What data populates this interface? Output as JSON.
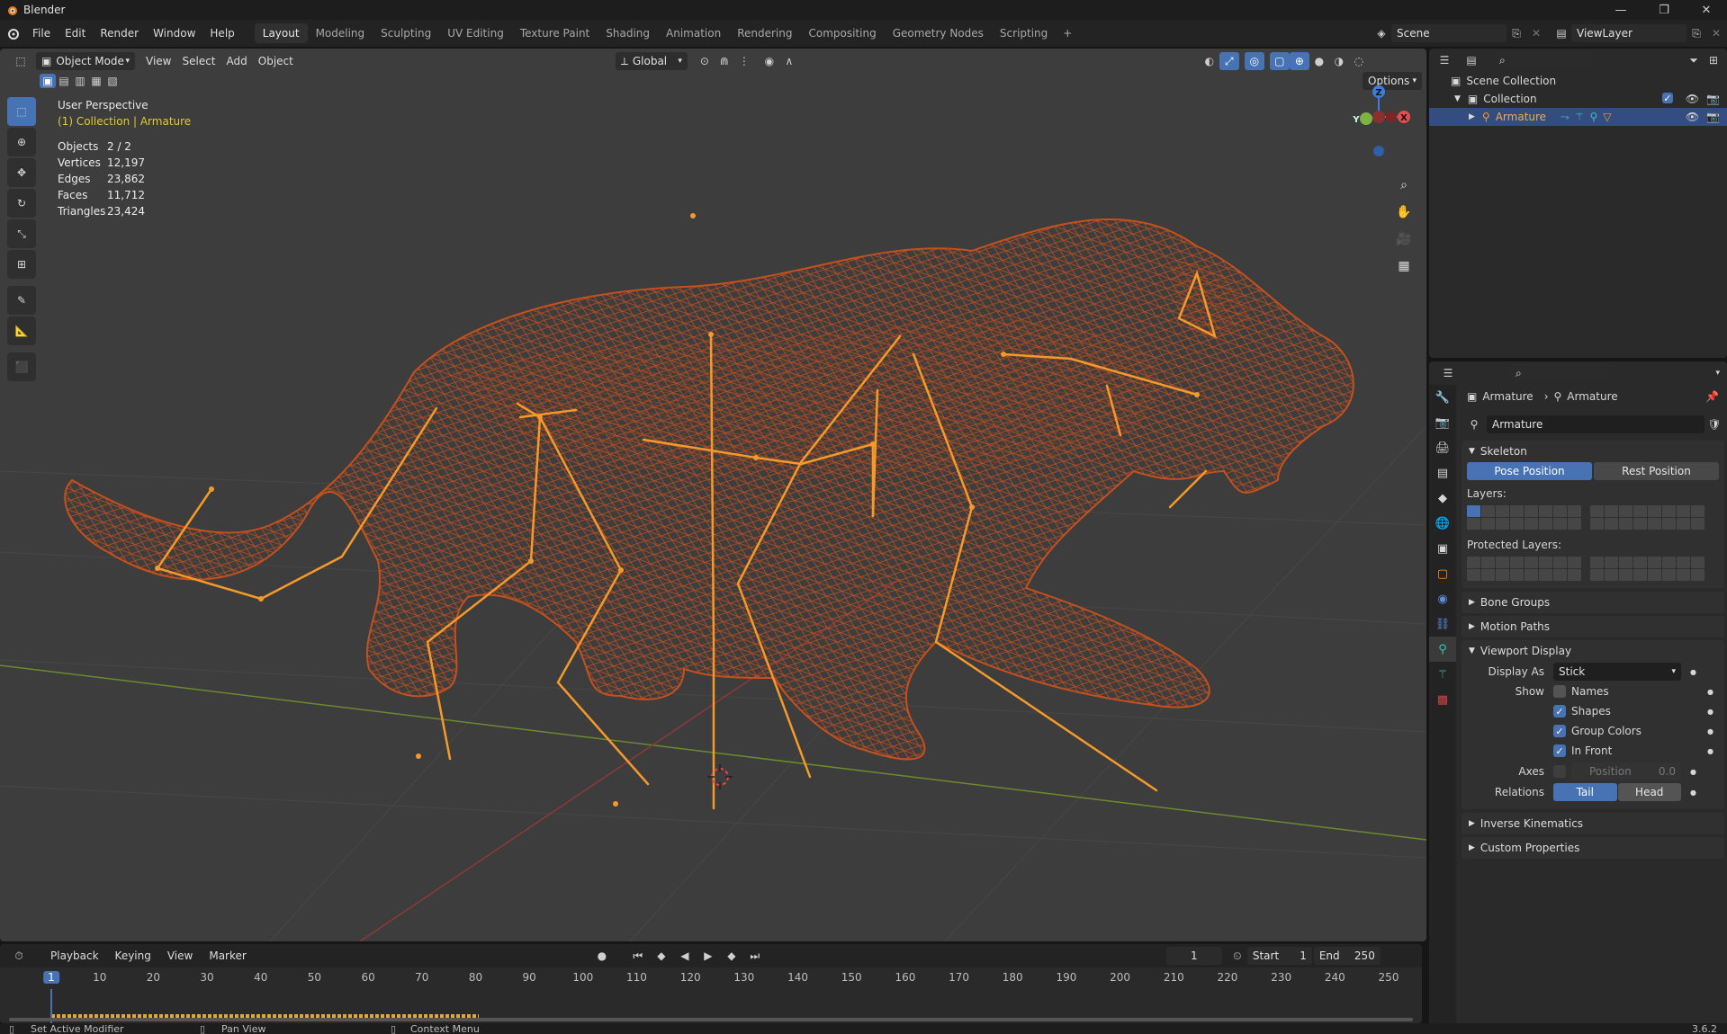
{
  "window": {
    "title": "Blender",
    "version": "3.6.2"
  },
  "menus": [
    "File",
    "Edit",
    "Render",
    "Window",
    "Help"
  ],
  "workspaces": [
    {
      "label": "Layout",
      "active": true
    },
    {
      "label": "Modeling"
    },
    {
      "label": "Sculpting"
    },
    {
      "label": "UV Editing"
    },
    {
      "label": "Texture Paint"
    },
    {
      "label": "Shading"
    },
    {
      "label": "Animation"
    },
    {
      "label": "Rendering"
    },
    {
      "label": "Compositing"
    },
    {
      "label": "Geometry Nodes"
    },
    {
      "label": "Scripting"
    }
  ],
  "scene": {
    "name": "Scene",
    "view_layer": "ViewLayer"
  },
  "viewport": {
    "mode": "Object Mode",
    "menus": [
      "View",
      "Select",
      "Add",
      "Object"
    ],
    "orientation": "Global",
    "options_label": "Options",
    "view_name": "User Perspective",
    "collection_line": "(1) Collection | Armature",
    "stats": [
      {
        "label": "Objects",
        "value": "2 / 2"
      },
      {
        "label": "Vertices",
        "value": "12,197"
      },
      {
        "label": "Edges",
        "value": "23,862"
      },
      {
        "label": "Faces",
        "value": "11,712"
      },
      {
        "label": "Triangles",
        "value": "23,424"
      }
    ],
    "gizmo": {
      "x": "X",
      "y": "Y",
      "z": "Z"
    },
    "colors": {
      "wire": "#c4501e",
      "bone": "#f59a2a",
      "grid_x": "#8b3a3a",
      "grid_y": "#6b8a2e",
      "background": "#3d3d3d"
    }
  },
  "outliner": {
    "root": "Scene Collection",
    "collection": "Collection",
    "object": "Armature"
  },
  "properties": {
    "breadcrumb_object": "Armature",
    "breadcrumb_data": "Armature",
    "data_name": "Armature",
    "skeleton_title": "Skeleton",
    "pose_position": "Pose Position",
    "rest_position": "Rest Position",
    "layers_label": "Layers:",
    "protected_layers_label": "Protected Layers:",
    "bone_groups": "Bone Groups",
    "motion_paths": "Motion Paths",
    "viewport_display": "Viewport Display",
    "display_as_label": "Display As",
    "display_as_value": "Stick",
    "show_label": "Show",
    "show_names": {
      "label": "Names",
      "checked": false
    },
    "show_shapes": {
      "label": "Shapes",
      "checked": true
    },
    "show_group_colors": {
      "label": "Group Colors",
      "checked": true
    },
    "show_in_front": {
      "label": "In Front",
      "checked": true
    },
    "axes_label": "Axes",
    "axes_position_label": "Position",
    "axes_position_value": "0.0",
    "relations_label": "Relations",
    "relations_tail": "Tail",
    "relations_head": "Head",
    "inverse_kinematics": "Inverse Kinematics",
    "custom_properties": "Custom Properties"
  },
  "timeline": {
    "menus": [
      "Playback",
      "Keying",
      "View",
      "Marker"
    ],
    "current_frame": "1",
    "start_label": "Start",
    "start": "1",
    "end_label": "End",
    "end": "250",
    "ticks": [
      "1",
      "10",
      "20",
      "30",
      "40",
      "50",
      "60",
      "70",
      "80",
      "90",
      "100",
      "110",
      "120",
      "130",
      "140",
      "150",
      "160",
      "170",
      "180",
      "190",
      "200",
      "210",
      "220",
      "230",
      "240",
      "250"
    ]
  },
  "statusbar": {
    "left": "Set Active Modifier",
    "middle": "Pan View",
    "right": "Context Menu"
  }
}
